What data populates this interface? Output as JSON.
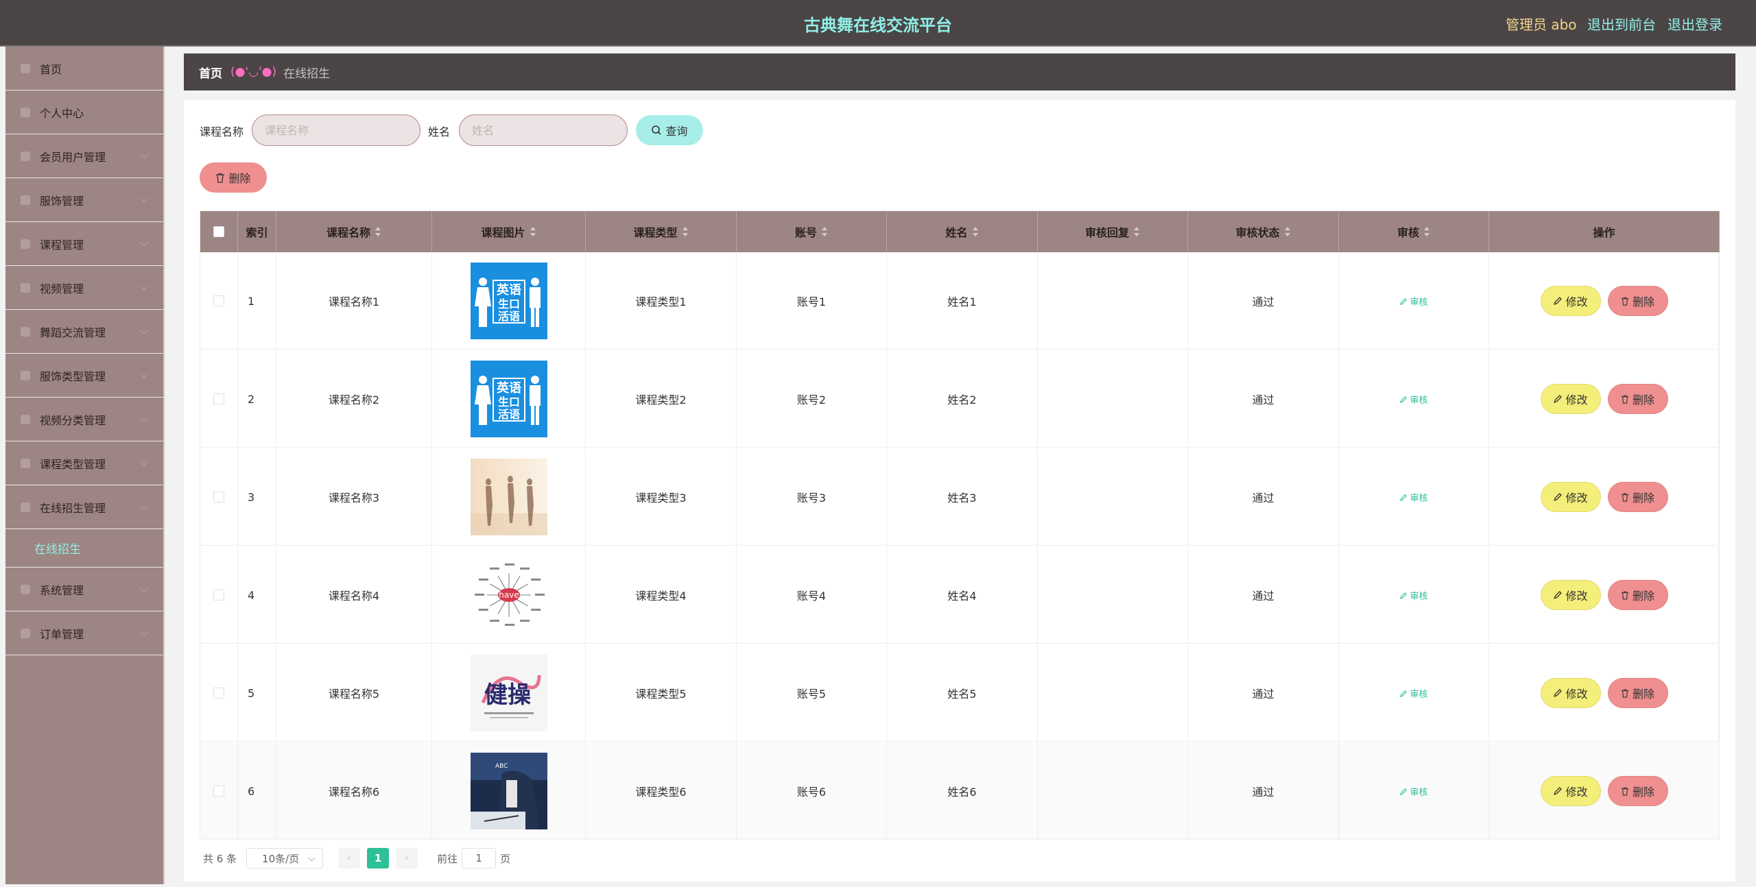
{
  "header": {
    "site_title": "古典舞在线交流平台",
    "admin_label": "管理员 abo",
    "to_front": "退出到前台",
    "logout": "退出登录"
  },
  "sidebar": {
    "items": [
      {
        "label": "首页",
        "icon": "home-icon"
      },
      {
        "label": "个人中心",
        "icon": "user-icon"
      },
      {
        "label": "会员用户管理",
        "icon": "users-icon"
      },
      {
        "label": "服饰管理",
        "icon": "shirt-icon"
      },
      {
        "label": "课程管理",
        "icon": "book-icon"
      },
      {
        "label": "视频管理",
        "icon": "video-icon"
      },
      {
        "label": "舞蹈交流管理",
        "icon": "chat-icon"
      },
      {
        "label": "服饰类型管理",
        "icon": "tag-icon"
      },
      {
        "label": "视频分类管理",
        "icon": "folder-icon"
      },
      {
        "label": "课程类型管理",
        "icon": "list-icon"
      },
      {
        "label": "在线招生管理",
        "icon": "enroll-icon"
      }
    ],
    "sub_active": "在线招生",
    "items_after": [
      {
        "label": "系统管理",
        "icon": "settings-icon"
      },
      {
        "label": "订单管理",
        "icon": "order-icon"
      }
    ]
  },
  "breadcrumb": {
    "home": "首页",
    "emoji": "(●'◡'●)",
    "current": "在线招生"
  },
  "search": {
    "course_label": "课程名称",
    "course_placeholder": "课程名称",
    "name_label": "姓名",
    "name_placeholder": "姓名",
    "query_button": "查询",
    "delete_button": "删除"
  },
  "table": {
    "headers": [
      "索引",
      "课程名称",
      "课程图片",
      "课程类型",
      "账号",
      "姓名",
      "审核回复",
      "审核状态",
      "审核",
      "操作"
    ],
    "rows": [
      {
        "index": "1",
        "course_name": "课程名称1",
        "course_type": "课程类型1",
        "account": "账号1",
        "name": "姓名1",
        "reply": "",
        "status": "通过",
        "image": "english-course"
      },
      {
        "index": "2",
        "course_name": "课程名称2",
        "course_type": "课程类型2",
        "account": "账号2",
        "name": "姓名2",
        "reply": "",
        "status": "通过",
        "image": "english-course"
      },
      {
        "index": "3",
        "course_name": "课程名称3",
        "course_type": "课程类型3",
        "account": "账号3",
        "name": "姓名3",
        "reply": "",
        "status": "通过",
        "image": "dancers"
      },
      {
        "index": "4",
        "course_name": "课程名称4",
        "course_type": "课程类型4",
        "account": "账号4",
        "name": "姓名4",
        "reply": "",
        "status": "通过",
        "image": "have-diagram"
      },
      {
        "index": "5",
        "course_name": "课程名称5",
        "course_type": "课程类型5",
        "account": "账号5",
        "name": "姓名5",
        "reply": "",
        "status": "通过",
        "image": "aerobics"
      },
      {
        "index": "6",
        "course_name": "课程名称6",
        "course_type": "课程类型6",
        "account": "账号6",
        "name": "姓名6",
        "reply": "",
        "status": "通过",
        "image": "office-study"
      }
    ],
    "audit_label": "审核",
    "edit_label": "修改",
    "delete_label": "删除"
  },
  "images": {
    "english_line1": "英语",
    "english_line2": "生口",
    "english_line3": "活语",
    "have_word": "have",
    "aerobics_text": "健操",
    "office_text": "ABC"
  },
  "pagination": {
    "total": "共 6 条",
    "page_size": "10条/页",
    "prev": "‹",
    "current_page": "1",
    "next": "›",
    "goto_label": "前往",
    "goto_value": "1",
    "page_suffix": "页"
  },
  "colors": {
    "header_bg": "#4b4546",
    "accent": "#8ff0e6",
    "sidebar_bg": "#9c8582",
    "table_header_bg": "#9c8582",
    "edit_btn": "#f4ee7a",
    "delete_btn": "#ef8f8f",
    "query_btn": "#a8eee8",
    "audit_text": "#2bbf9a"
  }
}
